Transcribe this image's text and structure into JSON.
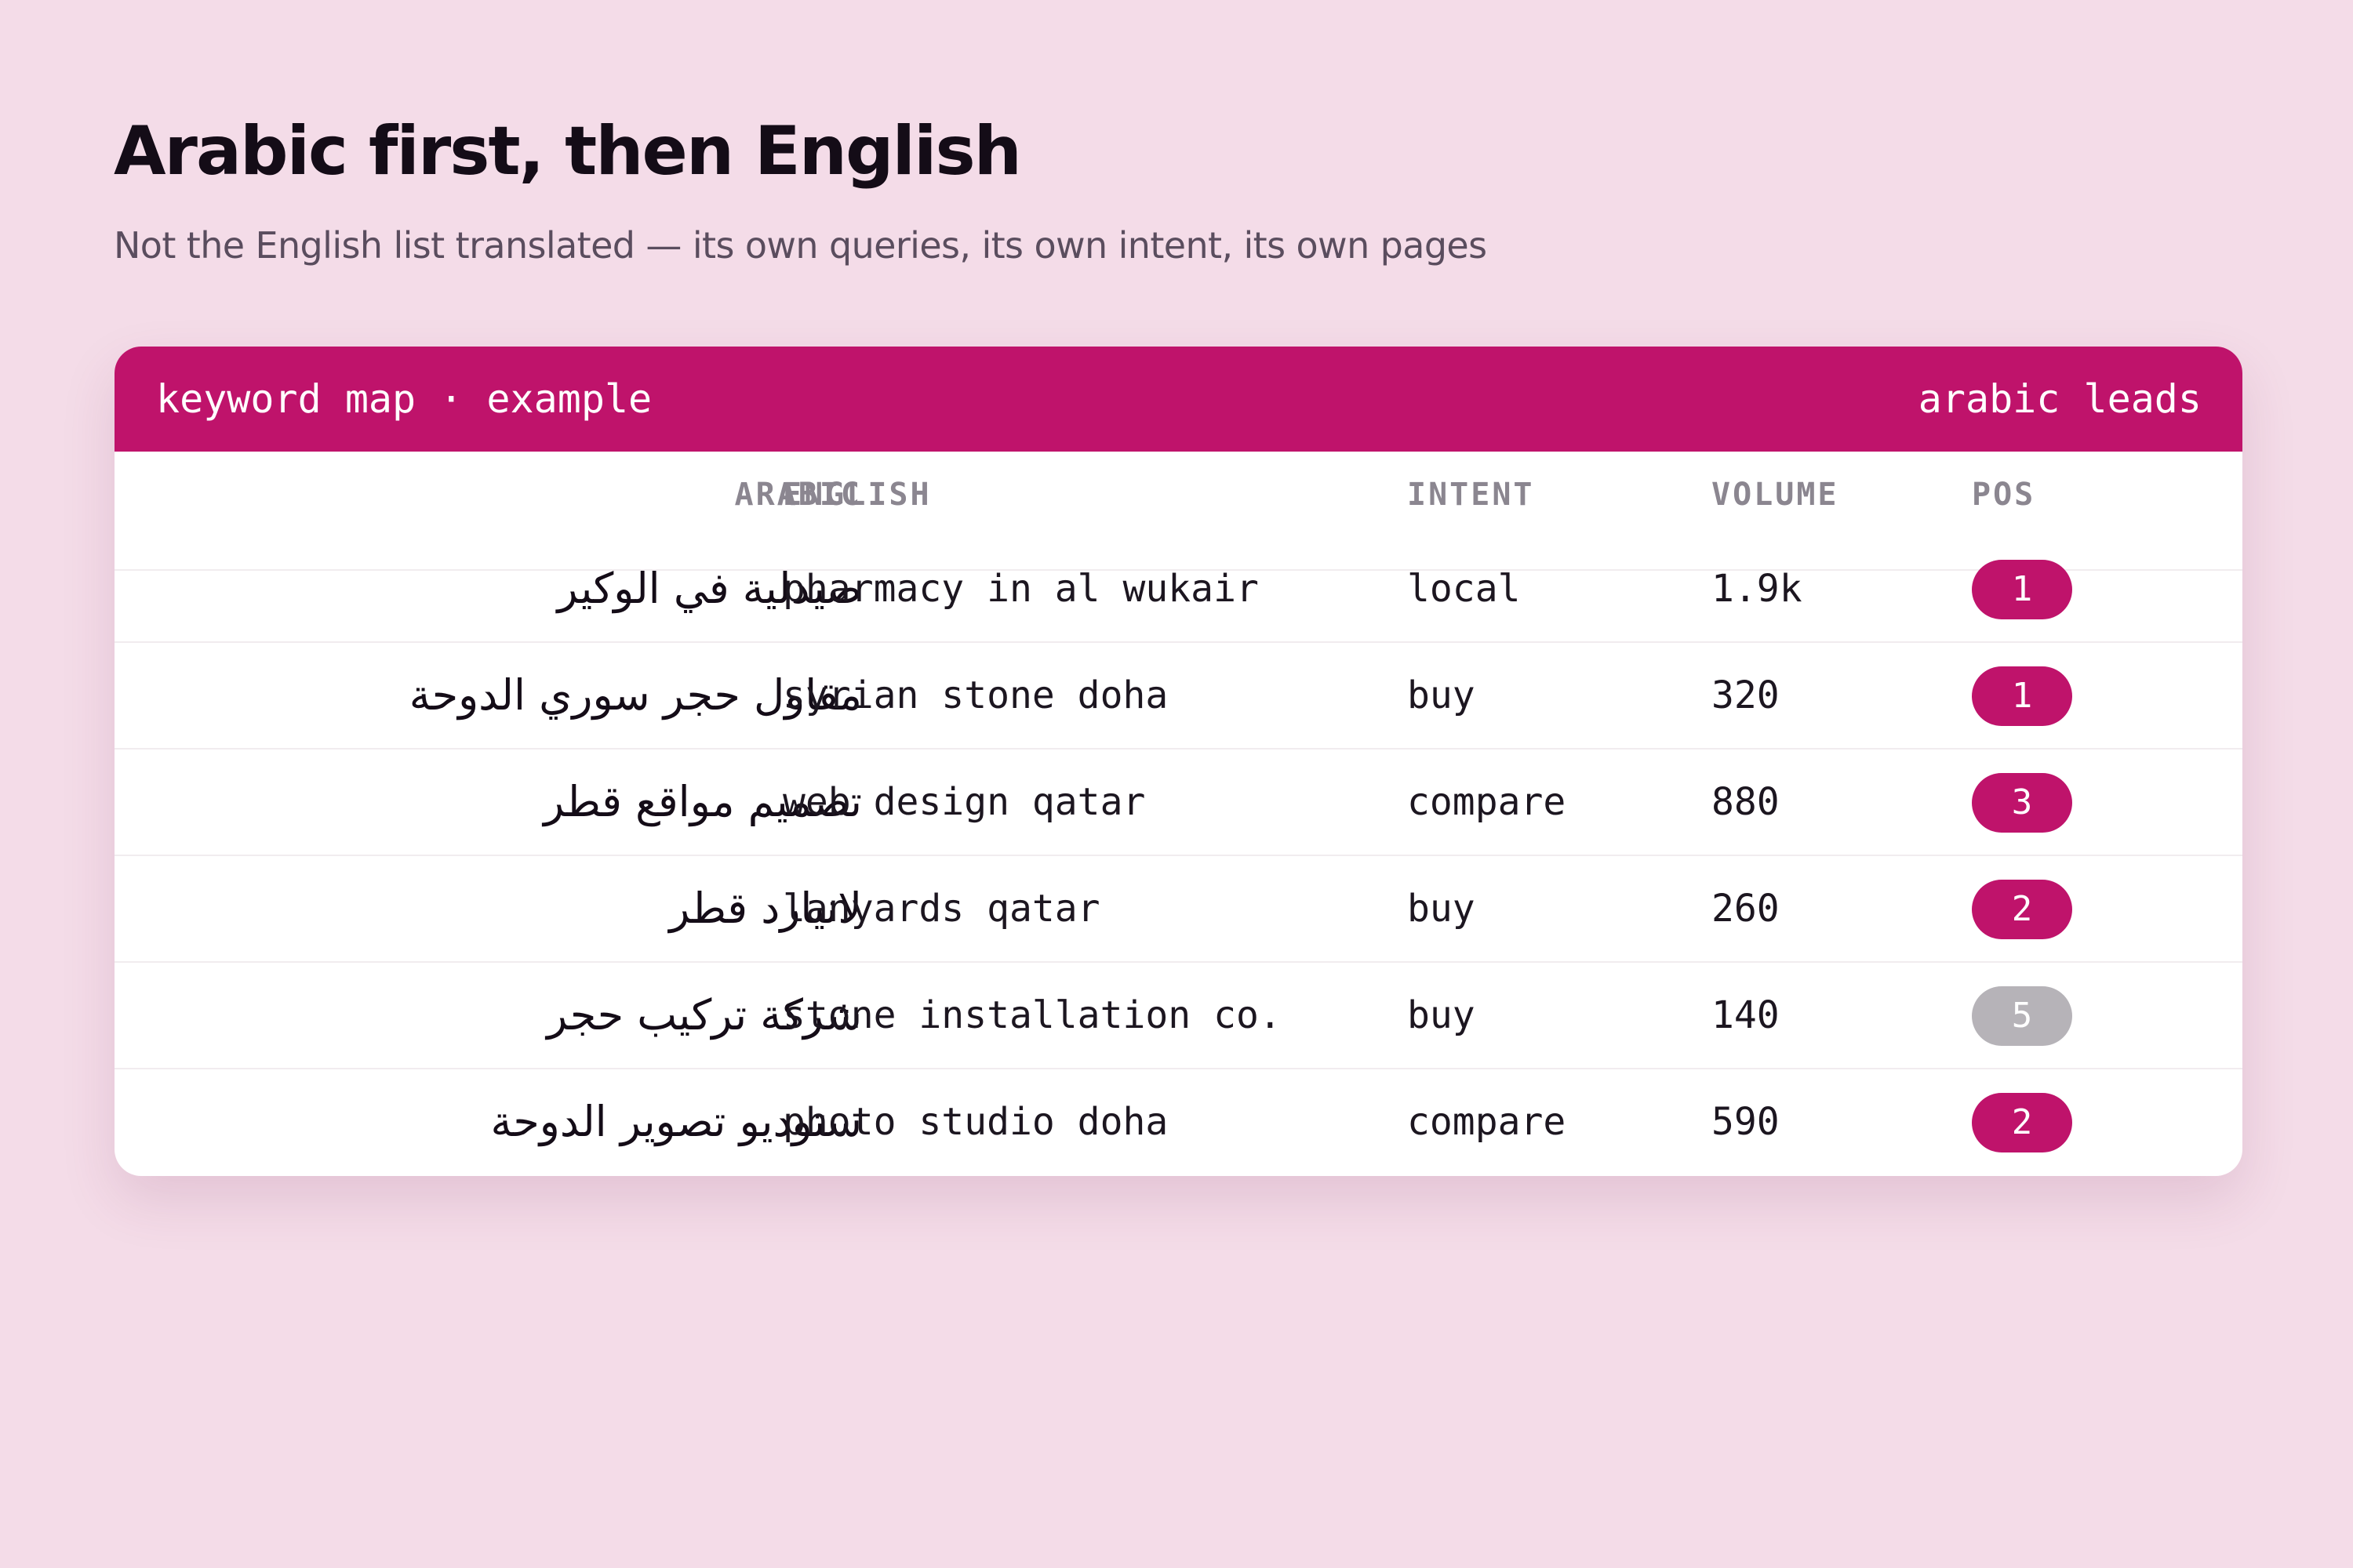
{
  "page": {
    "title": "Arabic first, then English",
    "subtitle": "Not the English list translated — its own queries, its own intent, its own pages"
  },
  "card": {
    "header_left": "keyword map · example",
    "header_right": "arabic leads",
    "columns": {
      "arabic": "ARABIC",
      "english": "ENGLISH",
      "intent": "INTENT",
      "volume": "VOLUME",
      "pos": "POS"
    },
    "rows": [
      {
        "arabic": "صيدلية في الوكير",
        "english": "pharmacy in al wukair",
        "intent": "local",
        "volume": "1.9k",
        "pos": "1",
        "highlight": true
      },
      {
        "arabic": "مقاول حجر سوري الدوحة",
        "english": "syrian stone doha",
        "intent": "buy",
        "volume": "320",
        "pos": "1",
        "highlight": true
      },
      {
        "arabic": "تصميم مواقع قطر",
        "english": "web design qatar",
        "intent": "compare",
        "volume": "880",
        "pos": "3",
        "highlight": true
      },
      {
        "arabic": "لانيارد قطر",
        "english": "lanyards qatar",
        "intent": "buy",
        "volume": "260",
        "pos": "2",
        "highlight": true
      },
      {
        "arabic": "شركة تركيب حجر",
        "english": "stone installation co.",
        "intent": "buy",
        "volume": "140",
        "pos": "5",
        "highlight": false
      },
      {
        "arabic": "ستوديو تصوير الدوحة",
        "english": "photo studio doha",
        "intent": "compare",
        "volume": "590",
        "pos": "2",
        "highlight": true
      }
    ]
  },
  "colors": {
    "background": "#f4dce8",
    "accent": "#bf136b",
    "badge_muted": "#b6b3b8"
  }
}
